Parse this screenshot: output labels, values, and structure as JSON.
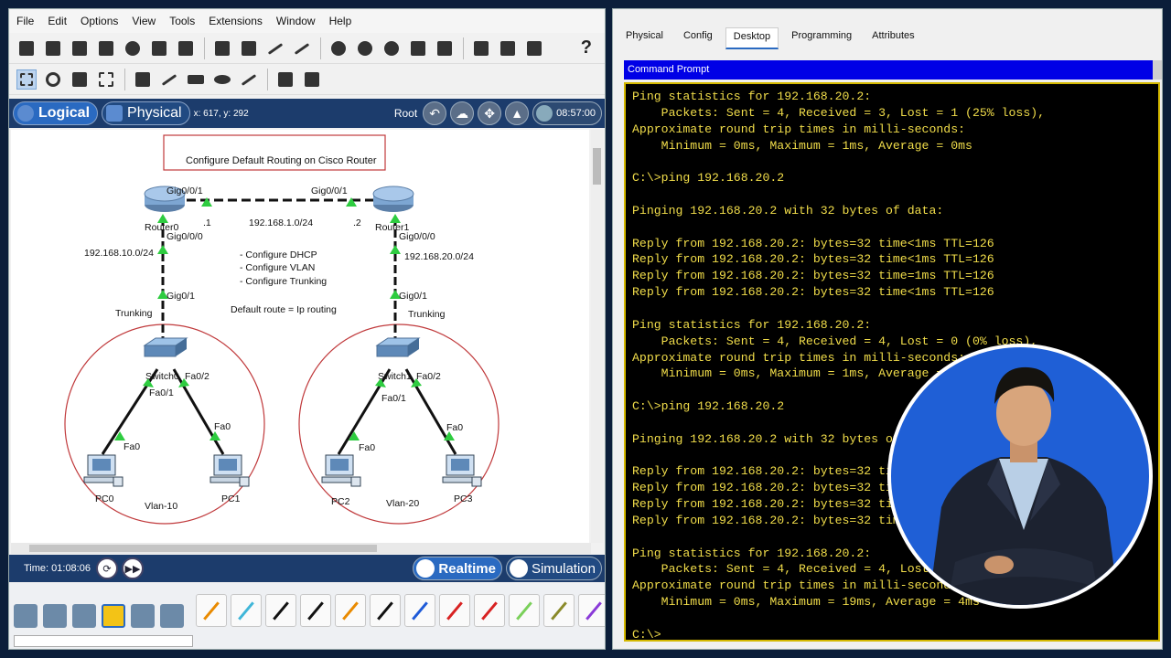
{
  "menu": [
    "File",
    "Edit",
    "Options",
    "View",
    "Tools",
    "Extensions",
    "Window",
    "Help"
  ],
  "help_glyph": "?",
  "modebar": {
    "logical": "Logical",
    "physical": "Physical",
    "coords": "x: 617, y: 292",
    "root": "Root",
    "clock": "08:57:00"
  },
  "diagram": {
    "title": "Configure Default Routing on Cisco Router",
    "router_left_label": "Router0",
    "router_right_label": "Router1",
    "link_left_port": "Gig0/0/1",
    "link_right_port": "Gig0/0/1",
    "left_dot": ".1",
    "right_dot": ".2",
    "wan_net": "192.168.1.0/24",
    "left_router_down_port": "Gig0/0/0",
    "right_router_down_port": "Gig0/0/0",
    "left_lan": "192.168.10.0/24",
    "right_lan": "192.168.20.0/24",
    "left_switch_up_port": "Gig0/1",
    "right_switch_up_port": "Gig0/1",
    "left_trunk": "Trunking",
    "right_trunk": "Trunking",
    "notes": [
      "- Configure DHCP",
      "- Configure VLAN",
      "- Configure Trunking"
    ],
    "default_route": "Default route = Ip routing",
    "left_switch": {
      "name": "Switch0",
      "p1": "Fa0/1",
      "p2": "Fa0/2"
    },
    "right_switch": {
      "name": "Switch1",
      "p1": "Fa0/1",
      "p2": "Fa0/2"
    },
    "pc_port": "Fa0",
    "pcs": [
      "PC0",
      "PC1",
      "PC2",
      "PC3"
    ],
    "vlan_left": "Vlan-10",
    "vlan_right": "Vlan-20",
    "colors": {
      "link": "#111111",
      "port_ok": "#2ecc40",
      "vlan_circle": "#c0393b"
    }
  },
  "status": {
    "time": "Time: 01:08:06",
    "realtime": "Realtime",
    "simulation": "Simulation"
  },
  "pc_tabs": [
    "Physical",
    "Config",
    "Desktop",
    "Programming",
    "Attributes"
  ],
  "selected_tab": "Desktop",
  "cmd_title": "Command Prompt",
  "terminal_lines": [
    "Ping statistics for 192.168.20.2:",
    "    Packets: Sent = 4, Received = 3, Lost = 1 (25% loss),",
    "Approximate round trip times in milli-seconds:",
    "    Minimum = 0ms, Maximum = 1ms, Average = 0ms",
    "",
    "C:\\>ping 192.168.20.2",
    "",
    "Pinging 192.168.20.2 with 32 bytes of data:",
    "",
    "Reply from 192.168.20.2: bytes=32 time<1ms TTL=126",
    "Reply from 192.168.20.2: bytes=32 time<1ms TTL=126",
    "Reply from 192.168.20.2: bytes=32 time=1ms TTL=126",
    "Reply from 192.168.20.2: bytes=32 time<1ms TTL=126",
    "",
    "Ping statistics for 192.168.20.2:",
    "    Packets: Sent = 4, Received = 4, Lost = 0 (0% loss),",
    "Approximate round trip times in milli-seconds:",
    "    Minimum = 0ms, Maximum = 1ms, Average = 0ms",
    "",
    "C:\\>ping 192.168.20.2",
    "",
    "Pinging 192.168.20.2 with 32 bytes of data:",
    "",
    "Reply from 192.168.20.2: bytes=32 time<1ms TTL=126",
    "Reply from 192.168.20.2: bytes=32 time<1ms TTL=126",
    "Reply from 192.168.20.2: bytes=32 time<1ms TTL=126",
    "Reply from 192.168.20.2: bytes=32 time=19ms TTL=126",
    "",
    "Ping statistics for 192.168.20.2:",
    "    Packets: Sent = 4, Received = 4, Lost = 0 (0% loss),",
    "Approximate round trip times in milli-seconds:",
    "    Minimum = 0ms, Maximum = 19ms, Average = 4ms",
    "",
    "C:\\>"
  ],
  "colors": {
    "frame": "#0b1e3a",
    "terminal_text": "#f1dd4a",
    "cmd_title_bg": "#0000e6"
  }
}
